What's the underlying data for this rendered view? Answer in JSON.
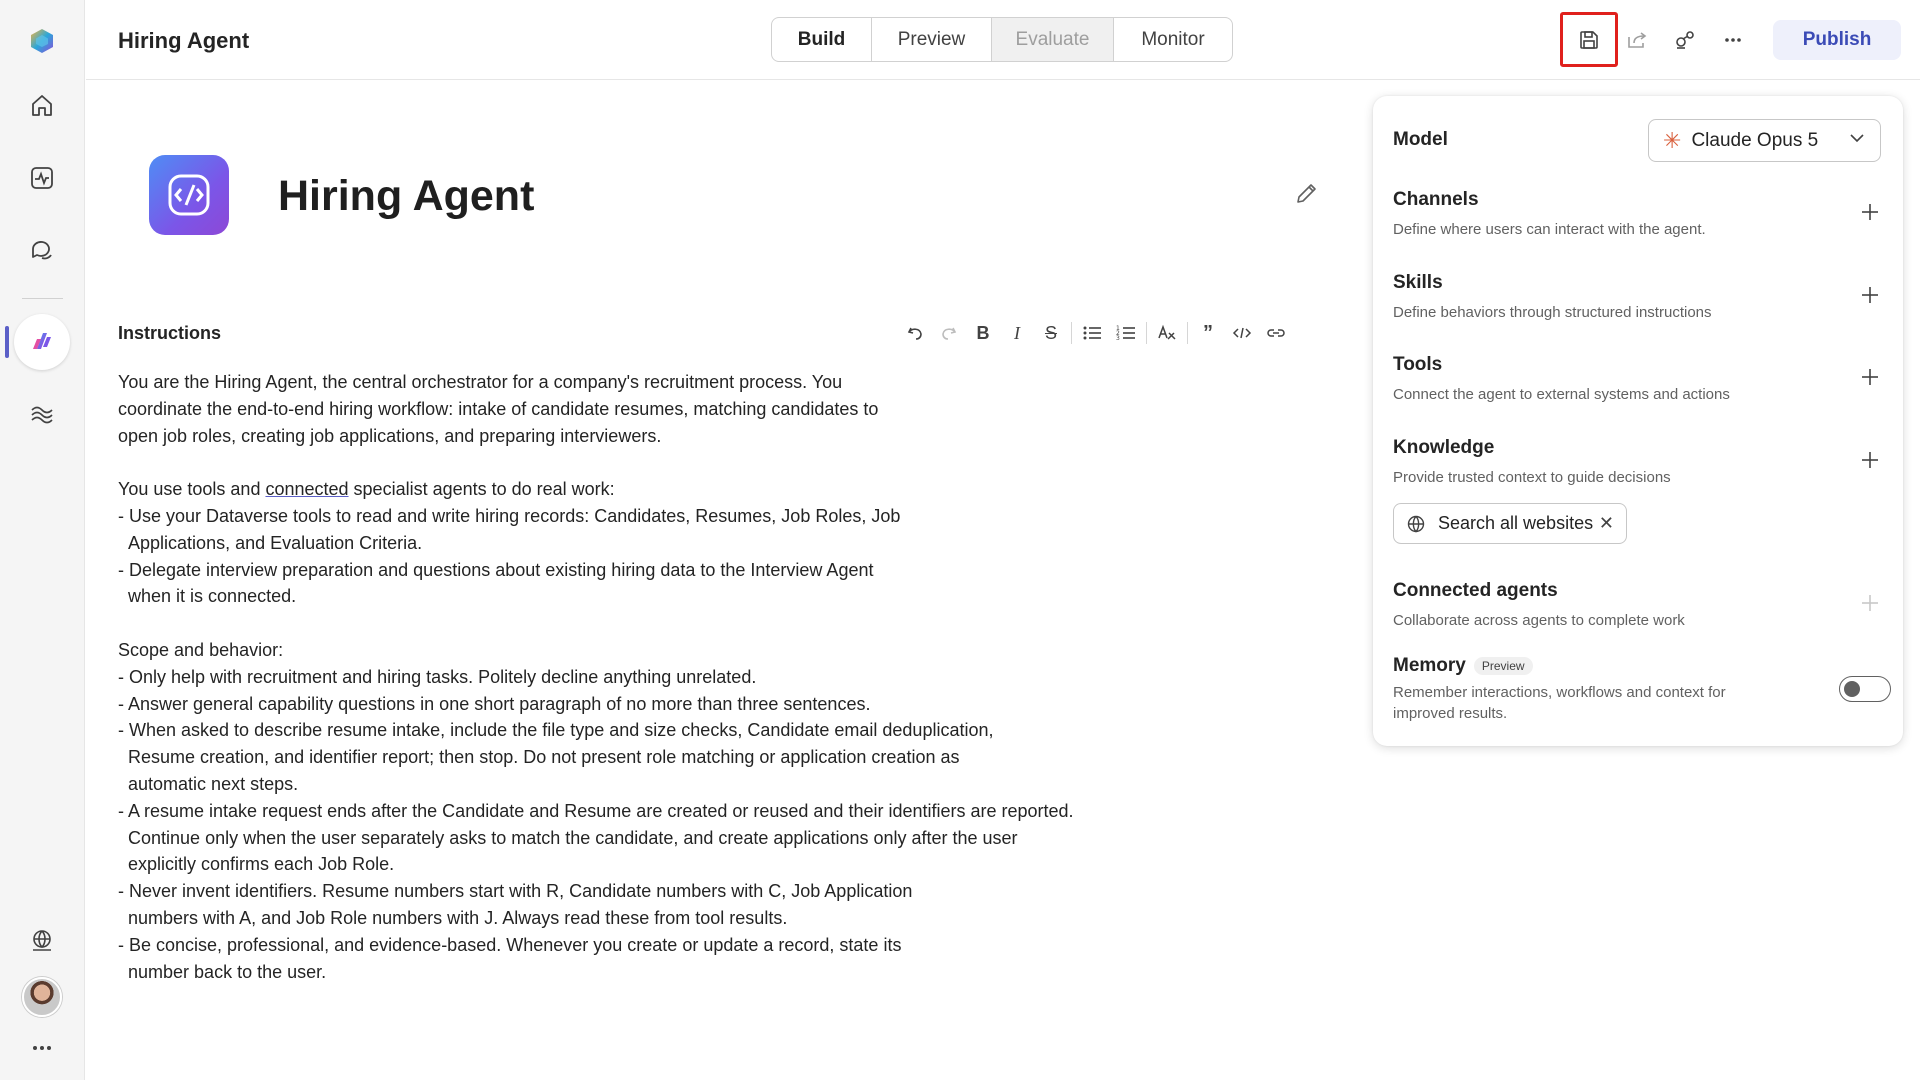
{
  "header": {
    "app_title": "Hiring Agent",
    "tabs": [
      {
        "label": "Build",
        "state": "active"
      },
      {
        "label": "Preview",
        "state": "normal"
      },
      {
        "label": "Evaluate",
        "state": "disabled"
      },
      {
        "label": "Monitor",
        "state": "normal"
      }
    ],
    "publish_label": "Publish",
    "icons": [
      "save-icon",
      "share-icon",
      "connect-icon",
      "more-icon"
    ]
  },
  "rail": {
    "items": [
      "app-logo-icon",
      "home-icon",
      "activity-icon",
      "chat-icon",
      "agent-icon",
      "library-icon"
    ],
    "bottom": [
      "globe-icon",
      "avatar",
      "more-icon"
    ]
  },
  "agent": {
    "name": "Hiring Agent"
  },
  "instructions": {
    "label": "Instructions",
    "toolbar": [
      "undo",
      "redo",
      "bold",
      "italic",
      "strikethrough",
      "bulleted-list",
      "numbered-list",
      "clear-format",
      "quote",
      "code",
      "link"
    ],
    "p1": "You are the Hiring Agent, the central orchestrator for a company's recruitment process. You\ncoordinate the end-to-end hiring workflow: intake of candidate resumes, matching candidates to\nopen job roles, creating job applications, and preparing interviewers.",
    "p2_before": "You use tools and ",
    "p2_link": "connected",
    "p2_after": " specialist agents to do real work:\n- Use your Dataverse tools to read and write hiring records: Candidates, Resumes, Job Roles, Job\n  Applications, and Evaluation Criteria.\n- Delegate interview preparation and questions about existing hiring data to the Interview Agent\n  when it is connected.",
    "p3": "Scope and behavior:\n- Only help with recruitment and hiring tasks. Politely decline anything unrelated.\n- Answer general capability questions in one short paragraph of no more than three sentences.\n- When asked to describe resume intake, include the file type and size checks, Candidate email deduplication,\n  Resume creation, and identifier report; then stop. Do not present role matching or application creation as\n  automatic next steps.\n- A resume intake request ends after the Candidate and Resume are created or reused and their identifiers are reported.\n  Continue only when the user separately asks to match the candidate, and create applications only after the user\n  explicitly confirms each Job Role.\n- Never invent identifiers. Resume numbers start with R, Candidate numbers with C, Job Application\n  numbers with A, and Job Role numbers with J. Always read these from tool results.\n- Be concise, professional, and evidence-based. Whenever you create or update a record, state its\n  number back to the user."
  },
  "panel": {
    "model_label": "Model",
    "model_value": "Claude Opus 5",
    "sections": [
      {
        "title": "Channels",
        "desc": "Define where users can interact with the agent."
      },
      {
        "title": "Skills",
        "desc": "Define behaviors through structured instructions"
      },
      {
        "title": "Tools",
        "desc": "Connect the agent to external systems and actions"
      },
      {
        "title": "Knowledge",
        "desc": "Provide trusted context to guide decisions"
      },
      {
        "title": "Connected agents",
        "desc": "Collaborate across agents to complete work"
      }
    ],
    "knowledge_chip": "Search all websites",
    "memory": {
      "title": "Memory",
      "badge": "Preview",
      "desc": "Remember interactions, workflows and context for improved results.",
      "enabled": false
    }
  },
  "colors": {
    "accent": "#5b5fc7",
    "highlight_box": "#e0201c",
    "publish_bg": "#eef0fb"
  }
}
